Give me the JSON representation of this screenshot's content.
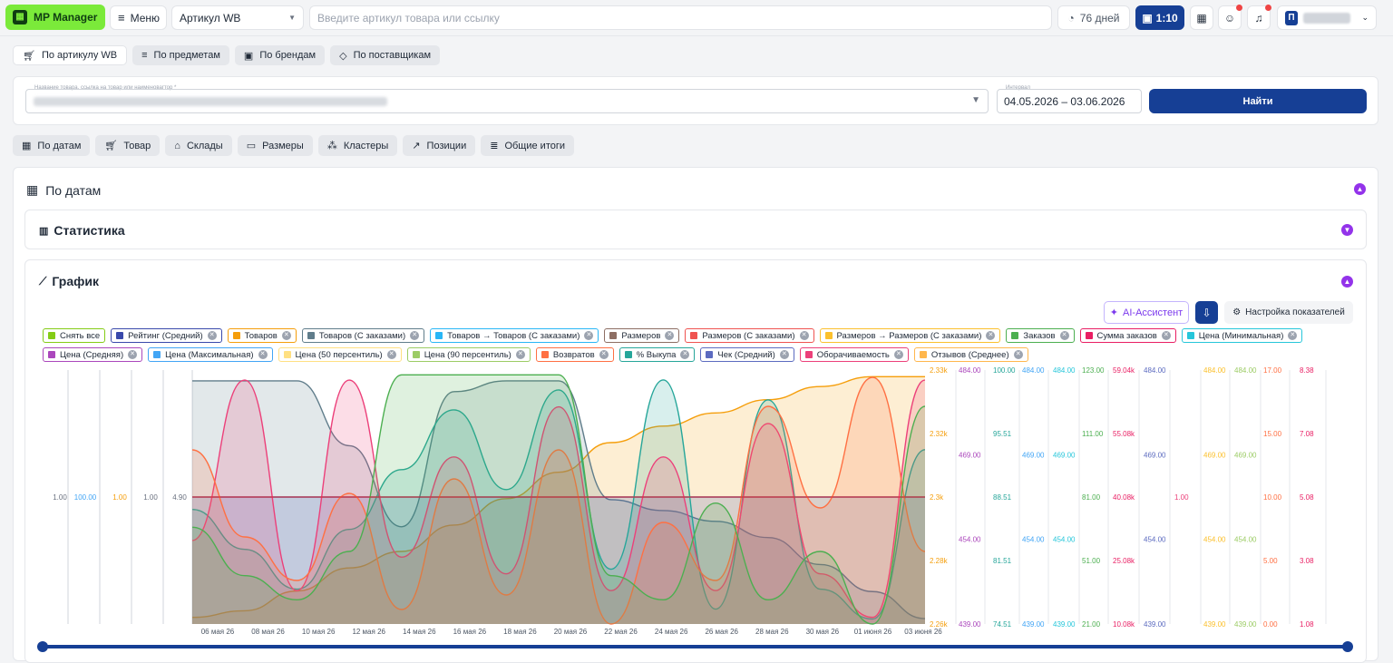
{
  "topbar": {
    "logo": "MP Manager",
    "menu": "Меню",
    "article_select": "Артикул WB",
    "search_placeholder": "Введите артикул товара или ссылку",
    "days": "76 дней",
    "record": "1:10",
    "avatar_letter": "П"
  },
  "tabs1": [
    "По артикулу WB",
    "По предметам",
    "По брендам",
    "По поставщикам"
  ],
  "filter": {
    "product_label": "Название товара, ссылка на товар или наименовагтор *",
    "interval_label": "Интервал",
    "interval_value": "04.05.2026 – 03.06.2026",
    "find": "Найти"
  },
  "tabs2": [
    "По датам",
    "Товар",
    "Склады",
    "Размеры",
    "Кластеры",
    "Позиции",
    "Общие итоги"
  ],
  "card": {
    "title": "По датам",
    "stats": "Статистика",
    "graph": "График",
    "ai": "AI-Ассистент",
    "settings": "Настройка показателей"
  },
  "chips": [
    {
      "label": "Снять все",
      "color": "#84cc16",
      "close": false
    },
    {
      "label": "Рейтинг (Средний)",
      "color": "#3949ab",
      "close": true
    },
    {
      "label": "Товаров",
      "color": "#f59e0b",
      "close": true
    },
    {
      "label": "Товаров (С заказами)",
      "color": "#607d8b",
      "close": true
    },
    {
      "label": "Товаров → Товаров (С заказами)",
      "color": "#29b6f6",
      "close": true
    },
    {
      "label": "Размеров",
      "color": "#8d6e63",
      "close": true
    },
    {
      "label": "Размеров (С заказами)",
      "color": "#ef5350",
      "close": true
    },
    {
      "label": "Размеров → Размеров (С заказами)",
      "color": "#fbc02d",
      "close": true
    },
    {
      "label": "Заказов",
      "color": "#4caf50",
      "close": true
    },
    {
      "label": "Сумма заказов",
      "color": "#e91e63",
      "close": true
    },
    {
      "label": "Цена (Минимальная)",
      "color": "#26c6da",
      "close": true
    },
    {
      "label": "Цена (Средняя)",
      "color": "#ab47bc",
      "close": true
    },
    {
      "label": "Цена (Максимальная)",
      "color": "#42a5f5",
      "close": true
    },
    {
      "label": "Цена (50 персентиль)",
      "color": "#ffe082",
      "close": true
    },
    {
      "label": "Цена (90 персентиль)",
      "color": "#9ccc65",
      "close": true
    },
    {
      "label": "Возвратов",
      "color": "#ff7043",
      "close": true
    },
    {
      "label": "% Выкупа",
      "color": "#26a69a",
      "close": true
    },
    {
      "label": "Чек (Средний)",
      "color": "#5c6bc0",
      "close": true
    },
    {
      "label": "Оборачиваемость",
      "color": "#ec407a",
      "close": true
    },
    {
      "label": "Отзывов (Среднее)",
      "color": "#ffb74d",
      "close": true
    }
  ],
  "chart_data": {
    "type": "area",
    "x": [
      "06 мая 26",
      "08 мая 26",
      "10 мая 26",
      "12 мая 26",
      "14 мая 26",
      "16 мая 26",
      "18 мая 26",
      "20 мая 26",
      "22 мая 26",
      "24 мая 26",
      "26 мая 26",
      "28 мая 26",
      "30 мая 26",
      "01 июня 26",
      "03 июня 26"
    ],
    "left_axis_labels": [
      "1.00",
      "100.00",
      "1.00",
      "1.00",
      "4.90"
    ],
    "right_axes": [
      {
        "color": "#f59e0b",
        "ticks": [
          "2.33k",
          "2.32k",
          "2.3k",
          "2.28k",
          "2.26k"
        ]
      },
      {
        "color": "#ab47bc",
        "ticks": [
          "484.00",
          "469.00",
          "454.00",
          "439.00"
        ]
      },
      {
        "color": "#26a69a",
        "ticks": [
          "100.00",
          "95.51",
          "88.51",
          "81.51",
          "74.51"
        ]
      },
      {
        "color": "#42a5f5",
        "ticks": [
          "484.00",
          "469.00",
          "454.00",
          "439.00"
        ]
      },
      {
        "color": "#26c6da",
        "ticks": [
          "484.00",
          "469.00",
          "454.00",
          "439.00"
        ]
      },
      {
        "color": "#4caf50",
        "ticks": [
          "123.00",
          "111.00",
          "81.00",
          "51.00",
          "21.00"
        ]
      },
      {
        "color": "#e91e63",
        "ticks": [
          "59.04k",
          "55.08k",
          "40.08k",
          "25.08k",
          "10.08k"
        ]
      },
      {
        "color": "#5c6bc0",
        "ticks": [
          "484.00",
          "469.00",
          "454.00",
          "439.00"
        ]
      },
      {
        "color": "#ec407a",
        "ticks": [
          "1.00"
        ]
      },
      {
        "color": "#fbc02d",
        "ticks": [
          "484.00",
          "469.00",
          "454.00",
          "439.00"
        ]
      },
      {
        "color": "#9ccc65",
        "ticks": [
          "484.00",
          "469.00",
          "454.00",
          "439.00"
        ]
      },
      {
        "color": "#ff7043",
        "ticks": [
          "17.00",
          "15.00",
          "10.00",
          "5.00",
          "0.00"
        ]
      },
      {
        "color": "#e91e63",
        "ticks": [
          "8.38",
          "7.08",
          "5.08",
          "3.08",
          "1.08"
        ]
      }
    ],
    "series": [
      {
        "name": "Товаров",
        "color": "#f59e0b",
        "values": [
          2260,
          2262,
          2268,
          2275,
          2280,
          2288,
          2296,
          2304,
          2313,
          2318,
          2322,
          2326,
          2330,
          2333,
          2333
        ]
      },
      {
        "name": "Товаров (С заказами)",
        "color": "#607d8b",
        "values": [
          484,
          484,
          484,
          472,
          457,
          482,
          484,
          484,
          462,
          460,
          458,
          455,
          450,
          445,
          440
        ]
      },
      {
        "name": "Рейтинг (Средний)",
        "color": "#3949ab",
        "values": [
          4.9,
          4.9,
          4.9,
          4.9,
          4.9,
          4.9,
          4.9,
          4.9,
          4.9,
          4.9,
          4.9,
          4.9,
          4.9,
          4.9,
          4.9
        ]
      },
      {
        "name": "% Выкупа",
        "color": "#26a69a",
        "values": [
          86,
          82,
          78,
          84,
          90,
          96,
          88,
          98,
          80,
          99,
          76,
          97,
          78,
          75,
          92
        ]
      },
      {
        "name": "Оборачиваемость",
        "color": "#ec407a",
        "values": [
          3.5,
          8.3,
          2.0,
          8.3,
          3.0,
          6.0,
          2.5,
          7.5,
          2.0,
          6.0,
          2.0,
          7.0,
          2.5,
          1.2,
          8.3
        ]
      },
      {
        "name": "Возвратов",
        "color": "#ff7043",
        "values": [
          12,
          6,
          3,
          9,
          1,
          10,
          2,
          12,
          0,
          7,
          3,
          15,
          8,
          17,
          5
        ]
      },
      {
        "name": "Заказов",
        "color": "#4caf50",
        "values": [
          60,
          40,
          30,
          50,
          123,
          123,
          123,
          123,
          40,
          30,
          70,
          30,
          50,
          20,
          110
        ]
      }
    ]
  }
}
